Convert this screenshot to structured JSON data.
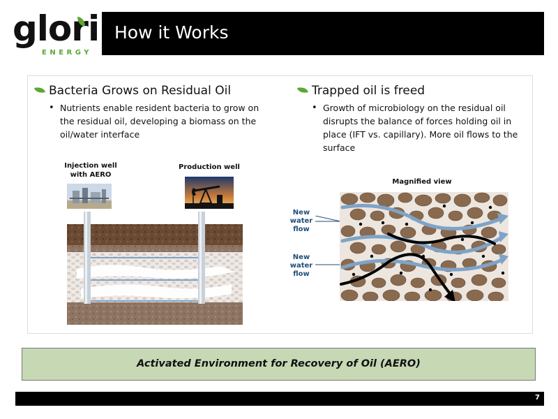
{
  "logo": {
    "word": "glori",
    "sub": "ENERGY"
  },
  "header": {
    "title": "How it Works"
  },
  "left": {
    "heading": "Bacteria Grows on Residual Oil",
    "bullet": "Nutrients enable resident bacteria to grow on the residual oil, developing a biomass on the oil/water interface",
    "injection_label_1": "Injection well",
    "injection_label_2": "with AERO",
    "production_label": "Production well"
  },
  "right": {
    "heading": "Trapped oil is freed",
    "bullet": "Growth of microbiology on the residual oil disrupts the balance of forces holding oil in place (IFT vs. capillary). More oil flows to the surface",
    "magnified_label": "Magnified view",
    "flow_label_1": "New water flow",
    "flow_label_2": "New water flow"
  },
  "footer": {
    "aero": "Activated Environment for Recovery of Oil (AERO)",
    "page": "7"
  },
  "colors": {
    "brand_green": "#5aa832",
    "aero_box": "#c7d8b4",
    "flow_blue": "#7fa3c7",
    "rock_brown": "#8a6a4f"
  }
}
